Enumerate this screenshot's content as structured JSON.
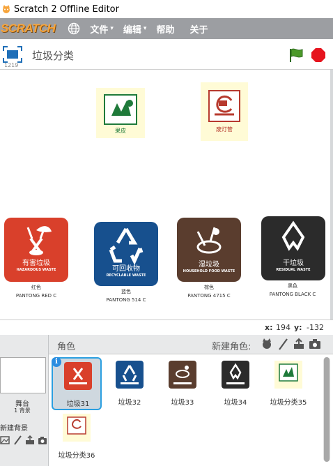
{
  "window": {
    "title": "Scratch 2 Offline Editor"
  },
  "menu": {
    "logo": "SCRATCH",
    "items": [
      {
        "label": "文件",
        "caret": "▾"
      },
      {
        "label": "编辑",
        "caret": "▾"
      },
      {
        "label": "帮助",
        "caret": ""
      },
      {
        "label": "关于",
        "caret": ""
      }
    ]
  },
  "stage_header": {
    "version": "1219",
    "project_title": "垃圾分类"
  },
  "stage": {
    "small_sprites": [
      {
        "label": "果皮"
      },
      {
        "label": "废灯管"
      }
    ],
    "bins": [
      {
        "cn": "有害垃圾",
        "en": "HAZARDOUS WASTE",
        "color": "#d9402b",
        "caption_cn": "红色",
        "caption_en": "PANTONG RED C"
      },
      {
        "cn": "可回收物",
        "en": "RECYCLABLE WASTE",
        "color": "#17508e",
        "caption_cn": "蓝色",
        "caption_en": "PANTONG 514 C"
      },
      {
        "cn": "湿垃圾",
        "en": "HOUSEHOLD FOOD WASTE",
        "color": "#5a3d2e",
        "caption_cn": "棕色",
        "caption_en": "PANTONG 4715 C"
      },
      {
        "cn": "干垃圾",
        "en": "RESIDUAL WASTE",
        "color": "#2b2b2b",
        "caption_cn": "黑色",
        "caption_en": "PANTONG BLACK C"
      }
    ]
  },
  "coords": {
    "x_label": "x:",
    "x": "194",
    "y_label": "y:",
    "y": "-132"
  },
  "stage_panel": {
    "label": "舞台",
    "bg_count": "1 背景",
    "new_bg": "新建背景"
  },
  "sprites_panel": {
    "role_label": "角色",
    "new_sprite_label": "新建角色:",
    "sprites": [
      {
        "name": "垃圾31",
        "selected": true
      },
      {
        "name": "垃圾32",
        "selected": false
      },
      {
        "name": "垃圾33",
        "selected": false
      },
      {
        "name": "垃圾34",
        "selected": false
      },
      {
        "name": "垃圾分类35",
        "selected": false
      },
      {
        "name": "垃圾分类36",
        "selected": false
      }
    ],
    "info_badge": "i"
  },
  "colors": {
    "accent": "#2b9fe0",
    "menubar": "#9c9ea2",
    "logo": "#f7a43a"
  }
}
